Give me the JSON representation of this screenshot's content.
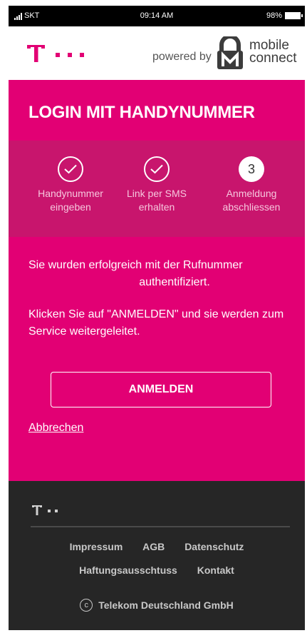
{
  "status_bar": {
    "carrier": "SKT",
    "time": "09:14 AM",
    "battery": "98%"
  },
  "header": {
    "powered_by": "powered by",
    "mc_line1": "mobile",
    "mc_line2": "connect"
  },
  "main": {
    "title": "LOGIN MIT HANDYNUMMER",
    "steps": [
      {
        "line1": "Handynummer",
        "line2": "eingeben"
      },
      {
        "line1": "Link per SMS",
        "line2": "erhalten"
      },
      {
        "number": "3",
        "line1": "Anmeldung",
        "line2": "abschliessen"
      }
    ],
    "message1_line1": "Sie wurden erfolgreich mit der Rufnummer",
    "message1_line2": "authentifiziert.",
    "message2": "Klicken Sie auf \"ANMELDEN\" und sie werden zum Service weitergeleitet.",
    "login_button": "ANMELDEN",
    "cancel_link": "Abbrechen"
  },
  "footer": {
    "links_row1": [
      "Impressum",
      "AGB",
      "Datenschutz"
    ],
    "links_row2": [
      "Haftungsausschtuss",
      "Kontakt"
    ],
    "copyright_symbol": "c",
    "copyright": "Telekom Deutschland GmbH"
  },
  "colors": {
    "magenta": "#e20074",
    "step_band": "#c8156d",
    "footer": "#262626"
  }
}
